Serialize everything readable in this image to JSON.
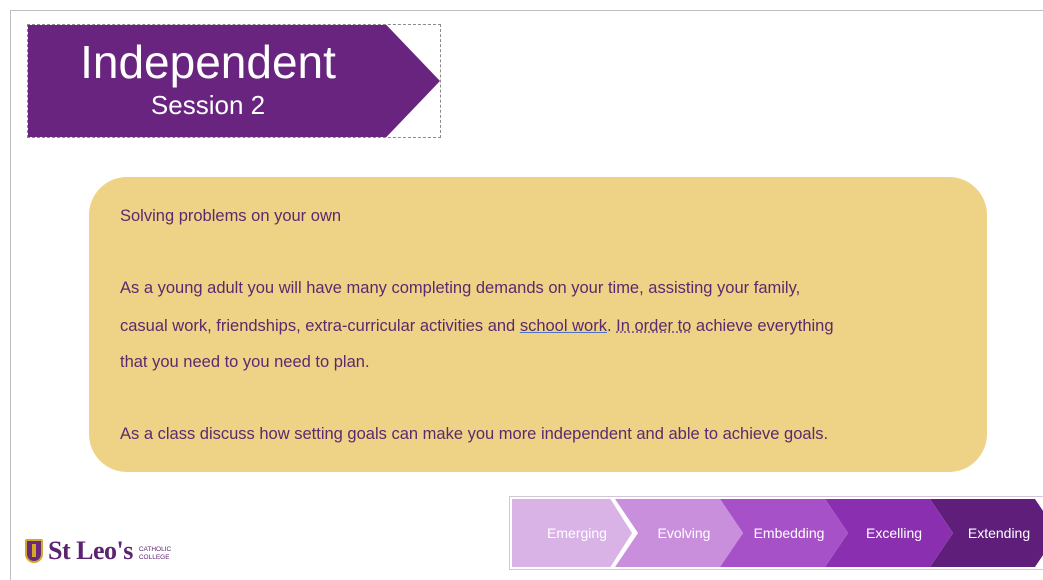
{
  "title": {
    "main": "Independent",
    "sub": "Session 2"
  },
  "card": {
    "heading": "Solving problems on your own",
    "para1_line1": "As a young adult you will have many completing demands on your time, assisting your family,",
    "para1_line2_a": "casual work, friendships, extra-curricular activities and ",
    "para1_line2_u1": "school work",
    "para1_line2_b": ". ",
    "para1_line2_u2": "In order to",
    "para1_line2_c": " achieve everything",
    "para1_line3": "that you need to you need to plan.",
    "para2": "As a class discuss how setting goals can make you more independent and able to achieve goals."
  },
  "progress": {
    "steps": [
      {
        "label": "Emerging",
        "color": "#d9b2e6"
      },
      {
        "label": "Evolving",
        "color": "#c98fdd"
      },
      {
        "label": "Embedding",
        "color": "#a751c9"
      },
      {
        "label": "Excelling",
        "color": "#8a2fb0"
      },
      {
        "label": "Extending",
        "color": "#5e1e79"
      }
    ]
  },
  "logo": {
    "name": "St Leo's",
    "line1": "CATHOLIC",
    "line2": "COLLEGE"
  }
}
